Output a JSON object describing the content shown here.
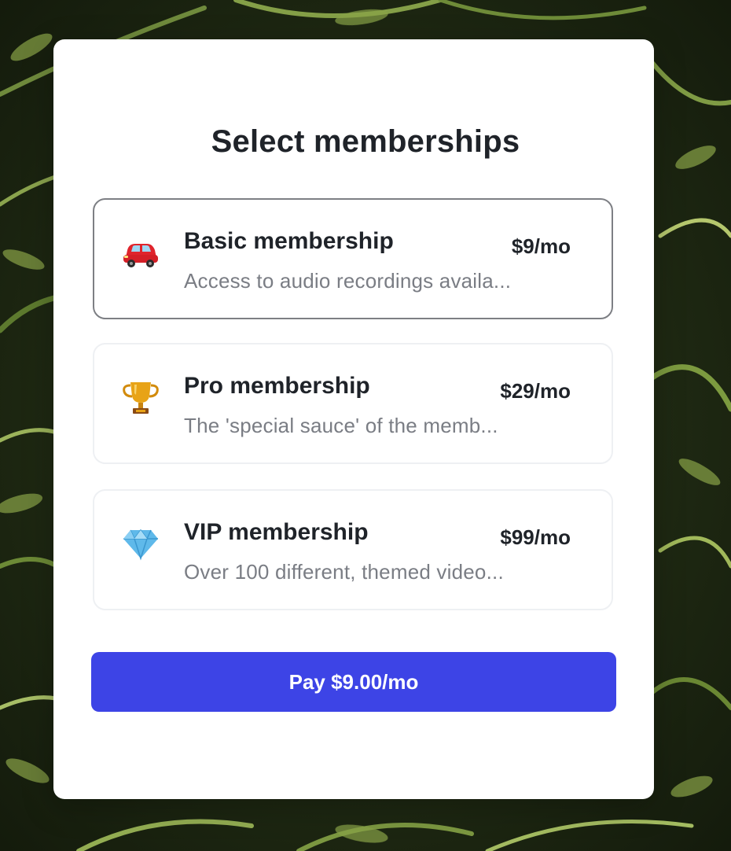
{
  "title": "Select memberships",
  "options": [
    {
      "icon": "car-icon",
      "name": "Basic membership",
      "price": "$9/mo",
      "description": "Access to audio recordings availa...",
      "selected": true
    },
    {
      "icon": "trophy-icon",
      "name": "Pro membership",
      "price": "$29/mo",
      "description": "The 'special sauce' of the memb...",
      "selected": false
    },
    {
      "icon": "gem-icon",
      "name": "VIP membership",
      "price": "$99/mo",
      "description": "Over 100 different, themed video...",
      "selected": false
    }
  ],
  "pay_button": "Pay $9.00/mo",
  "colors": {
    "accent": "#3d44e6",
    "selected_border": "#7d7f84",
    "card_border": "#eef0f3"
  }
}
